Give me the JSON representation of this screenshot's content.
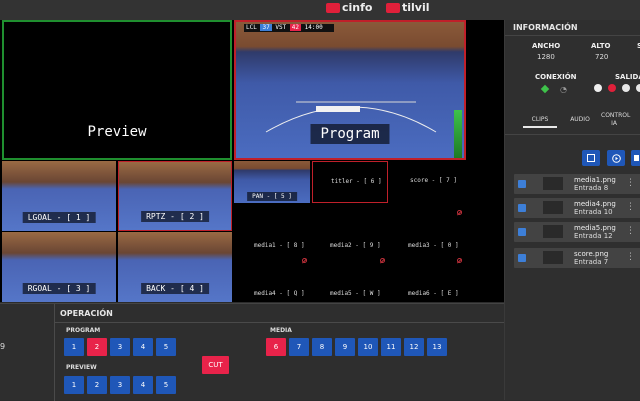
{
  "header": {
    "brand_left": "cinfo",
    "brand_right": "tilvil"
  },
  "multiview": {
    "preview_label": "Preview",
    "program_label": "Program",
    "scorebug": {
      "team_home": "LCL",
      "score_home": "37",
      "team_away": "VST",
      "score_away": "42",
      "extra": "14:00"
    },
    "cams": [
      {
        "label": "LGOAL - [ 1 ]"
      },
      {
        "label": "RPTZ - [ 2 ]"
      },
      {
        "label": "RGOAL - [ 3 ]"
      },
      {
        "label": "BACK - [ 4 ]"
      }
    ],
    "small_tiles": [
      {
        "label": "PAN - [ 5 ]"
      },
      {
        "label": "titler - [ 6 ]"
      },
      {
        "label": "score - [ 7 ]"
      }
    ],
    "media_slots": [
      {
        "label": "media1 - [ 8 ]"
      },
      {
        "label": "media2 - [ 9 ]"
      },
      {
        "label": "media3 - [ 0 ]"
      },
      {
        "label": "media4 - [ Q ]"
      },
      {
        "label": "media5 - [ W ]"
      },
      {
        "label": "media6 - [ E ]"
      }
    ]
  },
  "info": {
    "title": "INFORMACIÓN",
    "width_label": "ANCHO",
    "width_value": "1280",
    "height_label": "ALTO",
    "height_value": "720",
    "third_label": "S",
    "connection_label": "CONEXIÓN",
    "output_label": "SALIDA",
    "tabs": [
      "CLIPS",
      "AUDIO",
      "CONTROL IA"
    ],
    "clips": [
      {
        "name": "media1.png",
        "entry": "Entrada 8"
      },
      {
        "name": "media4.png",
        "entry": "Entrada 10"
      },
      {
        "name": "media5.png",
        "entry": "Entrada 12"
      },
      {
        "name": "score.png",
        "entry": "Entrada 7"
      }
    ]
  },
  "operation": {
    "title": "OPERACIÓN",
    "left_edge_digit": "9",
    "program_label": "PROGRAM",
    "preview_label": "PREVIEW",
    "media_label": "MEDIA",
    "cut_label": "CUT",
    "program_buttons": [
      "1",
      "2",
      "3",
      "4",
      "5"
    ],
    "program_active": "2",
    "preview_buttons": [
      "1",
      "2",
      "3",
      "4",
      "5"
    ],
    "media_buttons": [
      "6",
      "7",
      "8",
      "9",
      "10",
      "11",
      "12",
      "13"
    ],
    "media_active": "6"
  },
  "colors": {
    "accent_red": "#e8234a",
    "button_blue": "#1f57b8",
    "preview_border": "#1f8f2f",
    "program_border": "#c0202a"
  }
}
